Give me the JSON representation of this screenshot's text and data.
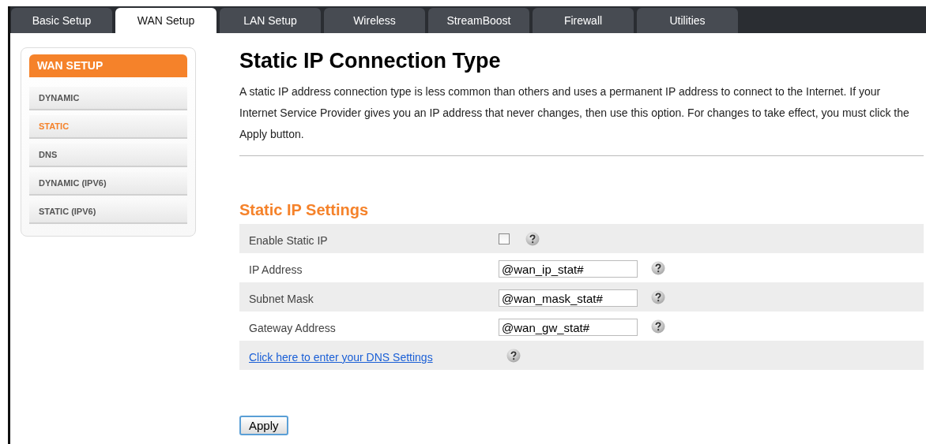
{
  "tabs": [
    {
      "label": "Basic Setup",
      "selected": false
    },
    {
      "label": "WAN Setup",
      "selected": true
    },
    {
      "label": "LAN Setup",
      "selected": false
    },
    {
      "label": "Wireless",
      "selected": false
    },
    {
      "label": "StreamBoost",
      "selected": false
    },
    {
      "label": "Firewall",
      "selected": false
    },
    {
      "label": "Utilities",
      "selected": false
    }
  ],
  "sidebar": {
    "title": "WAN SETUP",
    "items": [
      {
        "label": "DYNAMIC",
        "selected": false
      },
      {
        "label": "STATIC",
        "selected": true
      },
      {
        "label": "DNS",
        "selected": false
      },
      {
        "label": "DYNAMIC (IPV6)",
        "selected": false
      },
      {
        "label": "STATIC (IPV6)",
        "selected": false
      }
    ]
  },
  "page": {
    "title": "Static IP Connection Type",
    "description": "A static IP address connection type is less common than others and uses a permanent IP address to connect to the Internet. If your Internet Service Provider gives you an IP address that never changes, then use this option. For changes to take effect, you must click the Apply button."
  },
  "settings": {
    "title": "Static IP Settings",
    "rows": [
      {
        "kind": "checkbox",
        "label": "Enable Static IP",
        "checked": false
      },
      {
        "kind": "input",
        "label": "IP Address",
        "value": "@wan_ip_stat#"
      },
      {
        "kind": "input",
        "label": "Subnet Mask",
        "value": "@wan_mask_stat#"
      },
      {
        "kind": "input",
        "label": "Gateway Address",
        "value": "@wan_gw_stat#"
      },
      {
        "kind": "link",
        "label": "Click here to enter your DNS Settings"
      }
    ]
  },
  "apply_button": "Apply"
}
